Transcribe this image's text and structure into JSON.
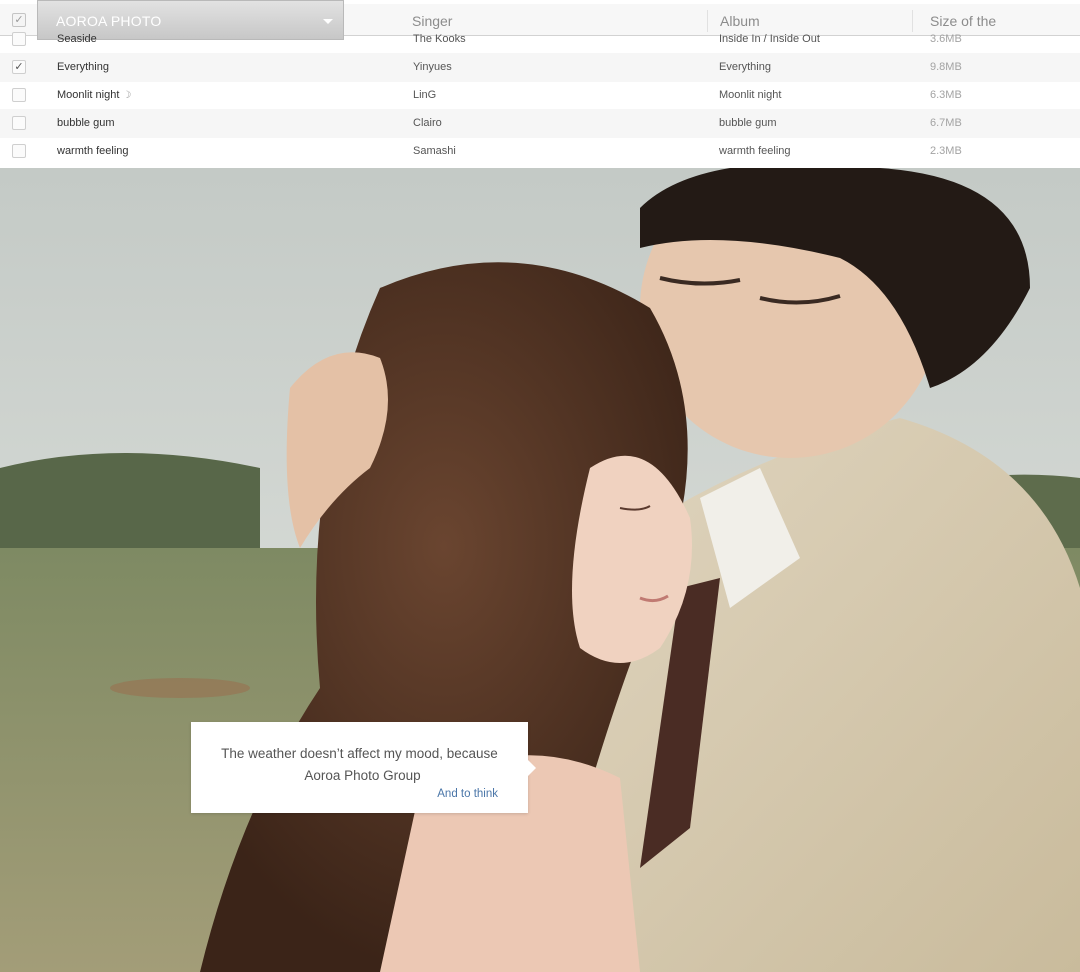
{
  "table": {
    "title": "AOROA PHOTO",
    "columns": {
      "singer": "Singer",
      "album": "Album",
      "size": "Size of the"
    },
    "rows": [
      {
        "title": "Seaside",
        "singer": "The Kooks",
        "album": "Inside In / Inside Out",
        "size": "3.6MB",
        "checked": false
      },
      {
        "title": "Everything",
        "singer": "Yinyues",
        "album": "Everything",
        "size": "9.8MB",
        "checked": true
      },
      {
        "title": "Moonlit night",
        "singer": "LinG",
        "album": "Moonlit night",
        "size": "6.3MB",
        "checked": false
      },
      {
        "title": "bubble gum",
        "singer": "Clairo",
        "album": "bubble gum",
        "size": "6.7MB",
        "checked": false
      },
      {
        "title": "warmth feeling",
        "singer": "Samashi",
        "album": "warmth feeling",
        "size": "2.3MB",
        "checked": false
      }
    ]
  },
  "caption": {
    "line1": "The weather doesn’t affect my mood, because",
    "line2": "Aoroa Photo Group",
    "link": "And to think"
  },
  "glyphs": {
    "check": "✓",
    "moon": "☽"
  },
  "colors": {
    "link": "#4a76a8",
    "dropdown": "#cfcfcf",
    "header_bg": "#f7f7f7"
  }
}
